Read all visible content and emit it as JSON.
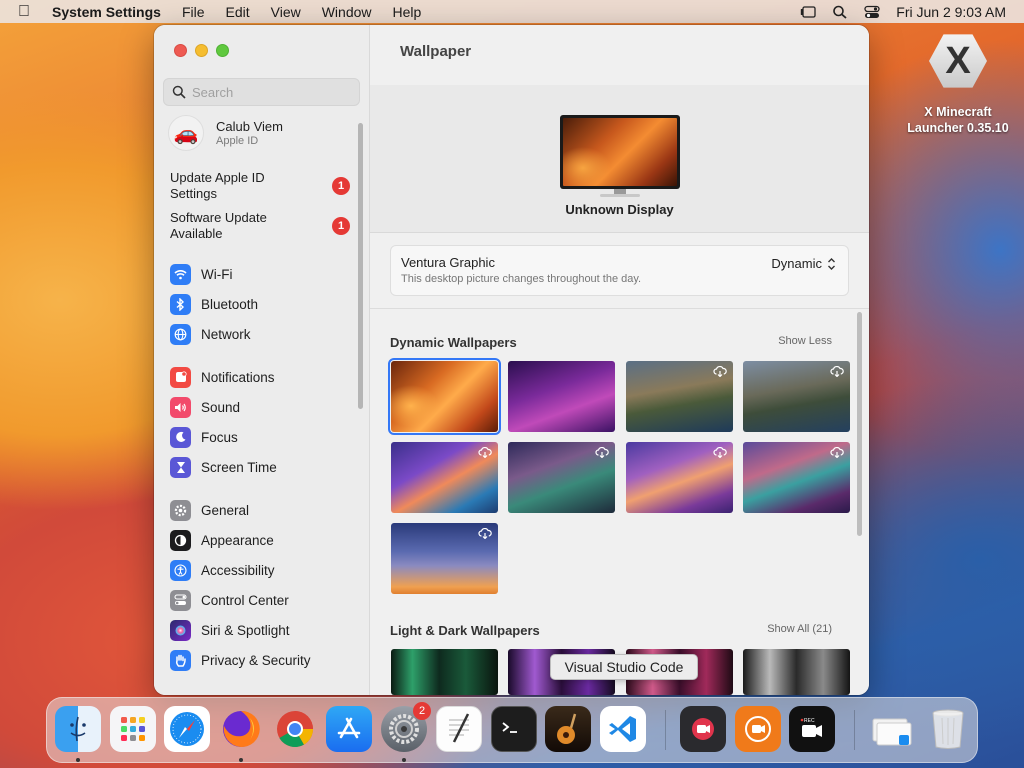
{
  "menubar": {
    "app_name": "System Settings",
    "items": [
      "File",
      "Edit",
      "View",
      "Window",
      "Help"
    ],
    "datetime": "Fri Jun 2  9:03 AM"
  },
  "desktop": {
    "app_label_line1": "X Minecraft",
    "app_label_line2": "Launcher 0.35.10",
    "app_icon_glyph": "X"
  },
  "sidebar": {
    "search_placeholder": "Search",
    "account": {
      "name": "Calub Viem",
      "subtitle": "Apple ID",
      "avatar_glyph": "🚗"
    },
    "notices": [
      {
        "label": "Update Apple ID Settings",
        "badge": "1"
      },
      {
        "label": "Software Update Available",
        "badge": "1"
      }
    ],
    "items": [
      {
        "label": "Wi-Fi",
        "icon": "wifi-icon",
        "color": "#2f7df6",
        "glyph": "≈"
      },
      {
        "label": "Bluetooth",
        "icon": "bluetooth-icon",
        "color": "#2f7df6",
        "glyph": "ᛒ"
      },
      {
        "label": "Network",
        "icon": "globe-icon",
        "color": "#2f7df6",
        "glyph": "◍"
      },
      {
        "label": "Notifications",
        "icon": "bell-icon",
        "color": "#f24a43",
        "glyph": "♪"
      },
      {
        "label": "Sound",
        "icon": "speaker-icon",
        "color": "#f24a6b",
        "glyph": "◀"
      },
      {
        "label": "Focus",
        "icon": "moon-icon",
        "color": "#5a57d6",
        "glyph": "☾"
      },
      {
        "label": "Screen Time",
        "icon": "hourglass-icon",
        "color": "#5a57d6",
        "glyph": "⧗"
      },
      {
        "label": "General",
        "icon": "gear-icon",
        "color": "#8e8e93",
        "glyph": "⚙"
      },
      {
        "label": "Appearance",
        "icon": "appearance-icon",
        "color": "#1c1c1e",
        "glyph": "◐"
      },
      {
        "label": "Accessibility",
        "icon": "accessibility-icon",
        "color": "#2f7df6",
        "glyph": "☺"
      },
      {
        "label": "Control Center",
        "icon": "toggle-icon",
        "color": "#8e8e93",
        "glyph": "◧"
      },
      {
        "label": "Siri & Spotlight",
        "icon": "siri-icon",
        "color": "#7b2ac7",
        "glyph": "●"
      },
      {
        "label": "Privacy & Security",
        "icon": "hand-icon",
        "color": "#2f7df6",
        "glyph": "✋"
      }
    ]
  },
  "content": {
    "title": "Wallpaper",
    "display_name": "Unknown Display",
    "wallpaper": {
      "name": "Ventura Graphic",
      "description": "This desktop picture changes throughout the day.",
      "mode": "Dynamic"
    },
    "sections": [
      {
        "title": "Dynamic Wallpapers",
        "link": "Show Less"
      },
      {
        "title": "Light & Dark Wallpapers",
        "link": "Show All (21)"
      }
    ]
  },
  "dock": {
    "tooltip": "Visual Studio Code",
    "settings_badge": "2",
    "apps": [
      {
        "name": "Finder",
        "icon": "finder-icon"
      },
      {
        "name": "Launchpad",
        "icon": "launchpad-icon"
      },
      {
        "name": "Safari",
        "icon": "safari-icon"
      },
      {
        "name": "Firefox",
        "icon": "firefox-icon"
      },
      {
        "name": "Chrome",
        "icon": "chrome-icon"
      },
      {
        "name": "App Store",
        "icon": "app-store-icon"
      },
      {
        "name": "System Settings",
        "icon": "system-settings-icon"
      },
      {
        "name": "TextEdit",
        "icon": "textedit-icon"
      },
      {
        "name": "Terminal",
        "icon": "terminal-icon"
      },
      {
        "name": "GarageBand",
        "icon": "garageband-icon"
      },
      {
        "name": "Visual Studio Code",
        "icon": "vscode-icon"
      },
      {
        "name": "Screen Recorder",
        "icon": "screen-recorder-icon"
      },
      {
        "name": "Screen Recorder Pro",
        "icon": "recorder-pro-icon"
      },
      {
        "name": "Video Recorder",
        "icon": "video-recorder-icon"
      },
      {
        "name": "Downloads",
        "icon": "downloads-stack-icon"
      },
      {
        "name": "Trash",
        "icon": "trash-icon"
      }
    ]
  }
}
